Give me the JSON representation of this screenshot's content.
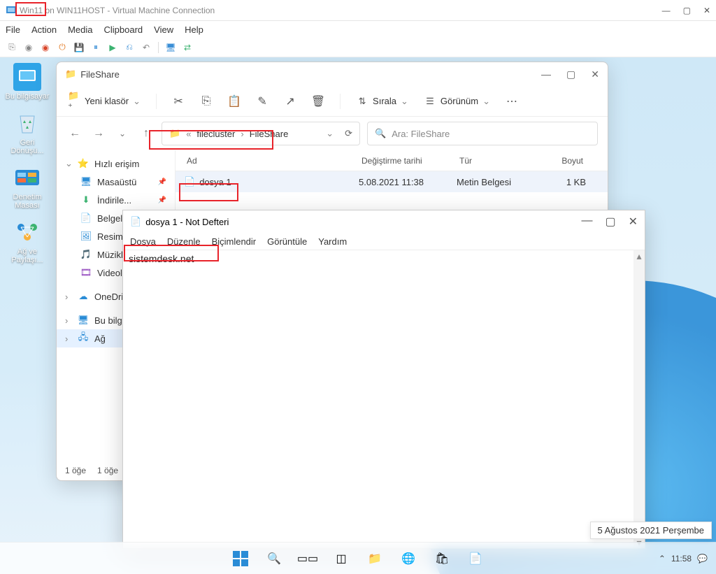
{
  "vm": {
    "title": "Win11 on WIN11HOST - Virtual Machine Connection",
    "title_highlight": "Win11",
    "menus": [
      "File",
      "Action",
      "Media",
      "Clipboard",
      "View",
      "Help"
    ]
  },
  "desktop_icons": [
    {
      "label": "Bu bilgisayar",
      "name": "this-pc-icon",
      "color": "#2fa4e7"
    },
    {
      "label": "Geri Dönüşü...",
      "name": "recycle-bin-icon",
      "color": "#7fb9e0"
    },
    {
      "label": "Denetim Masası",
      "name": "control-panel-icon",
      "color": "#2a8cd6"
    },
    {
      "label": "Ağ ve Paylaşı...",
      "name": "network-sharing-icon",
      "color": "#2a8cd6"
    }
  ],
  "explorer": {
    "title": "FileShare",
    "new_label": "Yeni klasör",
    "sort_label": "Sırala",
    "view_label": "Görünüm",
    "breadcrumbs": [
      "filecluster",
      "FileShare"
    ],
    "search_placeholder": "Ara: FileShare",
    "columns": {
      "name": "Ad",
      "modified": "Değiştirme tarihi",
      "type": "Tür",
      "size": "Boyut"
    },
    "sidebar": [
      {
        "label": "Hızlı erişim",
        "class": "",
        "name": "sidebar-item-quick-access",
        "expand": "⌄",
        "icon": "⭐",
        "icolor": "#f5b301"
      },
      {
        "label": "Masaüstü",
        "class": "sub",
        "name": "sidebar-item-desktop",
        "pin": "📌",
        "icon": "🖥",
        "icolor": "#2a8cd6"
      },
      {
        "label": "İndirile...",
        "class": "sub",
        "name": "sidebar-item-downloads",
        "pin": "📌",
        "icon": "⬇",
        "icolor": "#3cb371"
      },
      {
        "label": "Belgele...",
        "class": "sub",
        "name": "sidebar-item-documents",
        "pin": "",
        "icon": "📄",
        "icolor": "#888"
      },
      {
        "label": "Resiml...",
        "class": "sub",
        "name": "sidebar-item-pictures",
        "pin": "",
        "icon": "🖼",
        "icolor": "#2a8cd6"
      },
      {
        "label": "Müzikl...",
        "class": "sub",
        "name": "sidebar-item-music",
        "pin": "",
        "icon": "🎵",
        "icolor": "#d46bb0"
      },
      {
        "label": "Videol...",
        "class": "sub",
        "name": "sidebar-item-videos",
        "pin": "",
        "icon": "🎞",
        "icolor": "#8a3ab9"
      },
      {
        "label": "OneDriv...",
        "class": "",
        "name": "sidebar-item-onedrive",
        "expand": "›",
        "icon": "☁",
        "icolor": "#2a8cd6"
      },
      {
        "label": "Bu bilgi...",
        "class": "",
        "name": "sidebar-item-this-pc",
        "expand": "›",
        "icon": "🖥",
        "icolor": "#2a8cd6"
      },
      {
        "label": "Ağ",
        "class": "selected",
        "name": "sidebar-item-network",
        "expand": "›",
        "icon": "🖧",
        "icolor": "#2a8cd6"
      }
    ],
    "file_row": {
      "name": "dosya 1",
      "modified": "5.08.2021 11:38",
      "type": "Metin Belgesi",
      "size": "1 KB"
    },
    "status_left": "1 öğe",
    "status_selected": "1 öğe"
  },
  "notepad": {
    "title": "dosya 1 - Not Defteri",
    "menus": [
      "Dosya",
      "Düzenle",
      "Biçimlendir",
      "Görüntüle",
      "Yardım"
    ],
    "content": "sistemdesk.net"
  },
  "taskbar": {
    "time": "11:58",
    "date_tooltip": "5 Ağustos 2021 Perşembe"
  }
}
